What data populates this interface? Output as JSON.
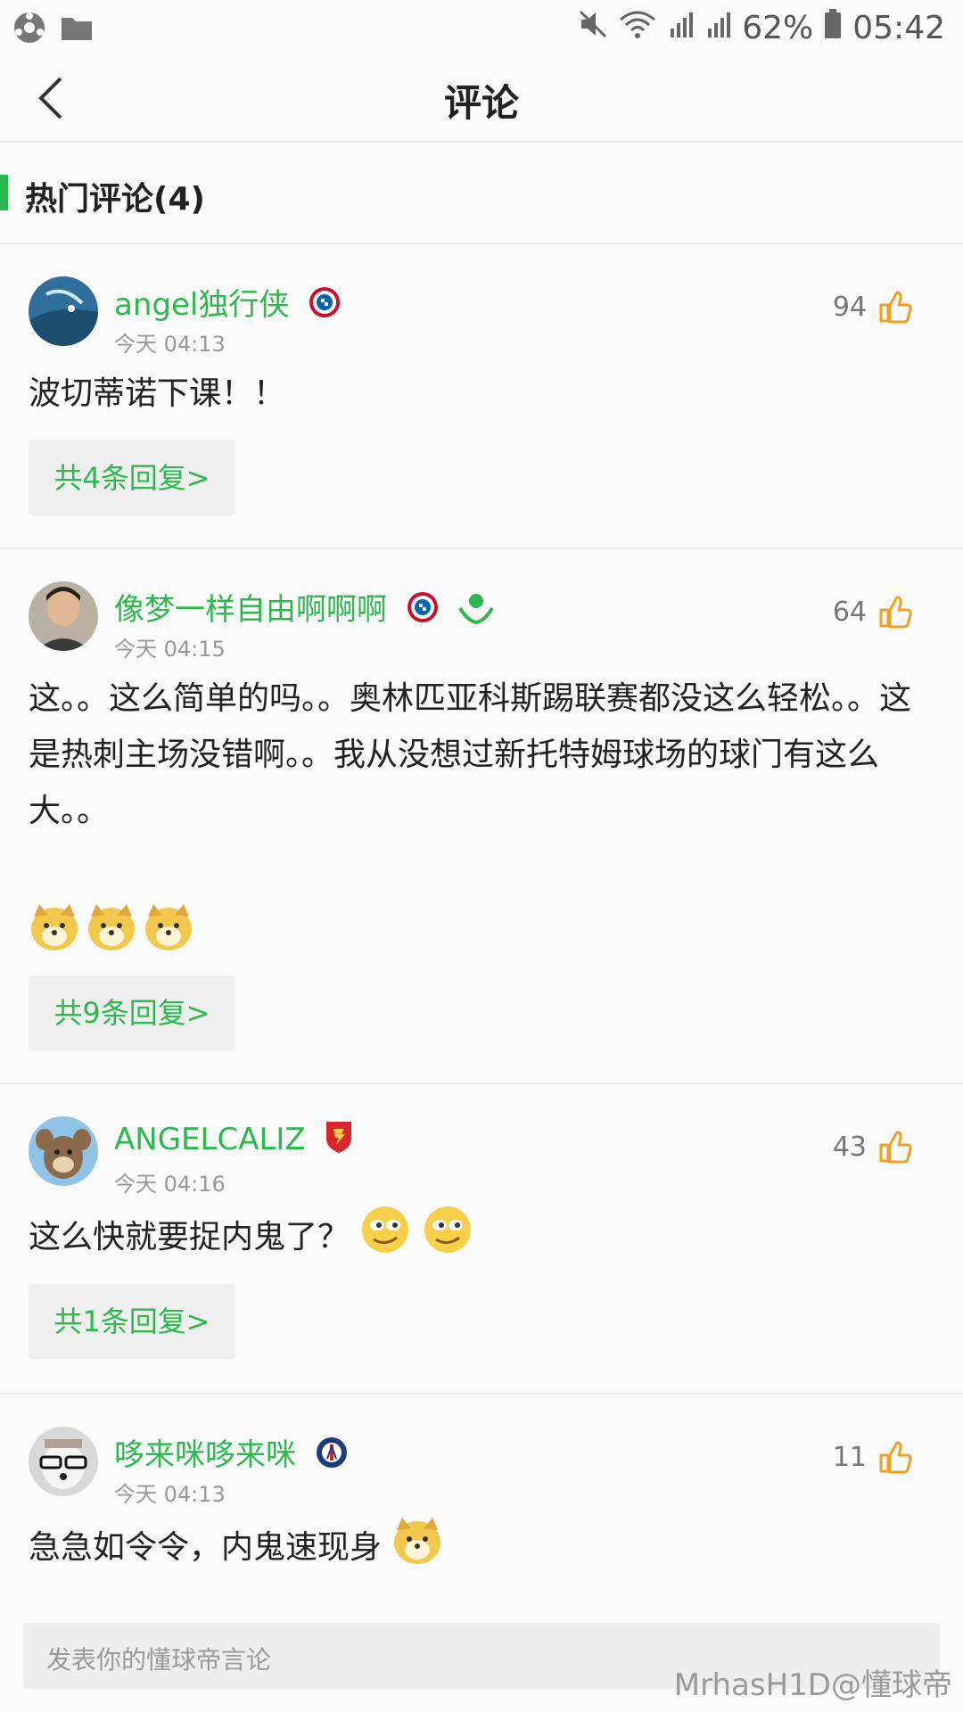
{
  "status_bar": {
    "battery": "62%",
    "time": "05:42"
  },
  "header": {
    "title": "评论"
  },
  "section": {
    "label": "热门评论(4)"
  },
  "comments": [
    {
      "user": "angel独行侠",
      "time": "今天 04:13",
      "likes": "94",
      "text": "波切蒂诺下课！！",
      "reply_label": "共4条回复>"
    },
    {
      "user": "像梦一样自由啊啊啊",
      "time": "今天 04:15",
      "likes": "64",
      "text": "这。。这么简单的吗。。奥林匹亚科斯踢联赛都没这么轻松。。这是热刺主场没错啊。。我从没想过新托特姆球场的球门有这么大。。",
      "reply_label": "共9条回复>"
    },
    {
      "user": "ANGELCALIZ",
      "time": "今天 04:16",
      "likes": "43",
      "text": "这么快就要捉内鬼了？",
      "reply_label": "共1条回复>"
    },
    {
      "user": "哆来咪哆来咪",
      "time": "今天 04:13",
      "likes": "11",
      "text": "急急如令令，内鬼速现身"
    }
  ],
  "input": {
    "placeholder": "发表你的懂球帝言论"
  },
  "watermark": "MrhasH1D@懂球帝",
  "colors": {
    "accent": "#2db84d",
    "background": "#fafafa",
    "divider": "#ececec",
    "like_icon": "#f0a020"
  }
}
